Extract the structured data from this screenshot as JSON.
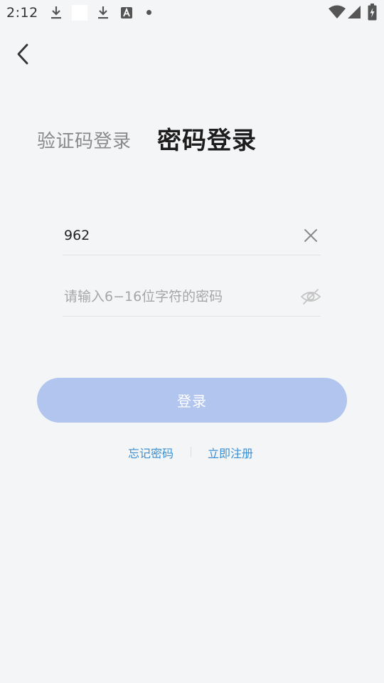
{
  "status_bar": {
    "time": "2:12",
    "icons": [
      "download-icon",
      "blank-notification-icon",
      "download-icon",
      "a-box-icon",
      "dot-icon",
      "wifi-icon",
      "signal-icon",
      "battery-charging-icon"
    ]
  },
  "nav": {
    "back_icon": "chevron-left-icon"
  },
  "tabs": {
    "sms_login": "验证码登录",
    "password_login": "密码登录",
    "active": "password_login"
  },
  "form": {
    "account_value": "962",
    "account_clear_icon": "close-icon",
    "password_placeholder": "请输入6−16位字符的密码",
    "password_visibility_icon": "eye-off-icon"
  },
  "login_button": {
    "label": "登录"
  },
  "links": {
    "forgot_password": "忘记密码",
    "register": "立即注册"
  },
  "colors": {
    "background": "#f4f5f7",
    "button_disabled": "#b1c5ef",
    "link": "#3a8fd4"
  }
}
